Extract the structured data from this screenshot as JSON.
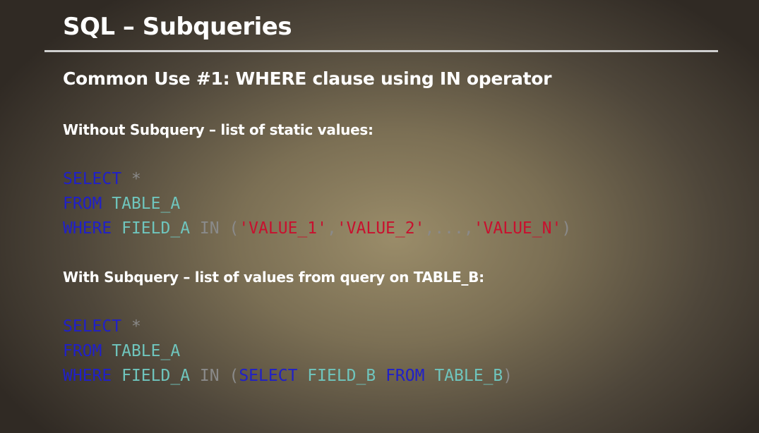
{
  "slide": {
    "title": "SQL – Subqueries",
    "subtitle": "Common Use #1:  WHERE clause using IN operator",
    "section1_label": "Without Subquery – list of static values:",
    "section2_label": "With Subquery – list of values from query on TABLE_B:",
    "code1": {
      "l1_kw": "SELECT",
      "l1_star": "*",
      "l2_kw": "FROM",
      "l2_table": "TABLE_A",
      "l3_kw": "WHERE",
      "l3_field": "FIELD_A",
      "l3_in": "IN",
      "l3_open": "(",
      "l3_v1": "'VALUE_1'",
      "l3_c1": ",",
      "l3_v2": "'VALUE_2'",
      "l3_dots": ",...,",
      "l3_vn": "'VALUE_N'",
      "l3_close": ")"
    },
    "code2": {
      "l1_kw": "SELECT",
      "l1_star": "*",
      "l2_kw": "FROM",
      "l2_table": "TABLE_A",
      "l3_kw": "WHERE",
      "l3_field": "FIELD_A",
      "l3_in": "IN",
      "l3_open": "(",
      "l3_sel": "SELECT",
      "l3_fieldb": "FIELD_B",
      "l3_from": "FROM",
      "l3_tableb": "TABLE_B",
      "l3_close": ")"
    },
    "colors": {
      "keyword": "#2020c8",
      "identifier": "#6fc5bd",
      "string": "#c8102e",
      "operator": "#8a8a8a"
    }
  }
}
